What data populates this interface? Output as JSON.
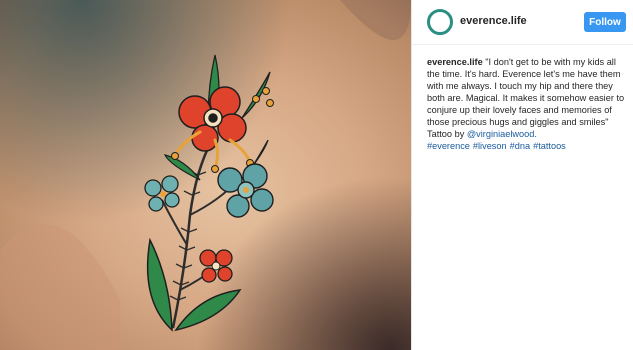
{
  "post": {
    "username": "everence.life",
    "follow_label": "Follow",
    "caption_user": "everence.life",
    "caption_text": "\"I don't get to be with my kids all the time. It's hard. Everence let's me have them with me always. I touch my hip and there they both are. Magical. It makes it somehow easier to conjure up their lovely faces and memories of those precious hugs and giggles and smiles\"",
    "credit_prefix": "Tattoo by ",
    "credit_user": "@virginiaelwood.",
    "hashtags": [
      "#everence",
      "#liveson",
      "#dna",
      "#tattoos"
    ]
  },
  "colors": {
    "accent": "#3897f0",
    "link": "#1a5b9c",
    "avatar_ring": "#2a8f82"
  },
  "icons": {
    "avatar": "profile-avatar-icon"
  }
}
